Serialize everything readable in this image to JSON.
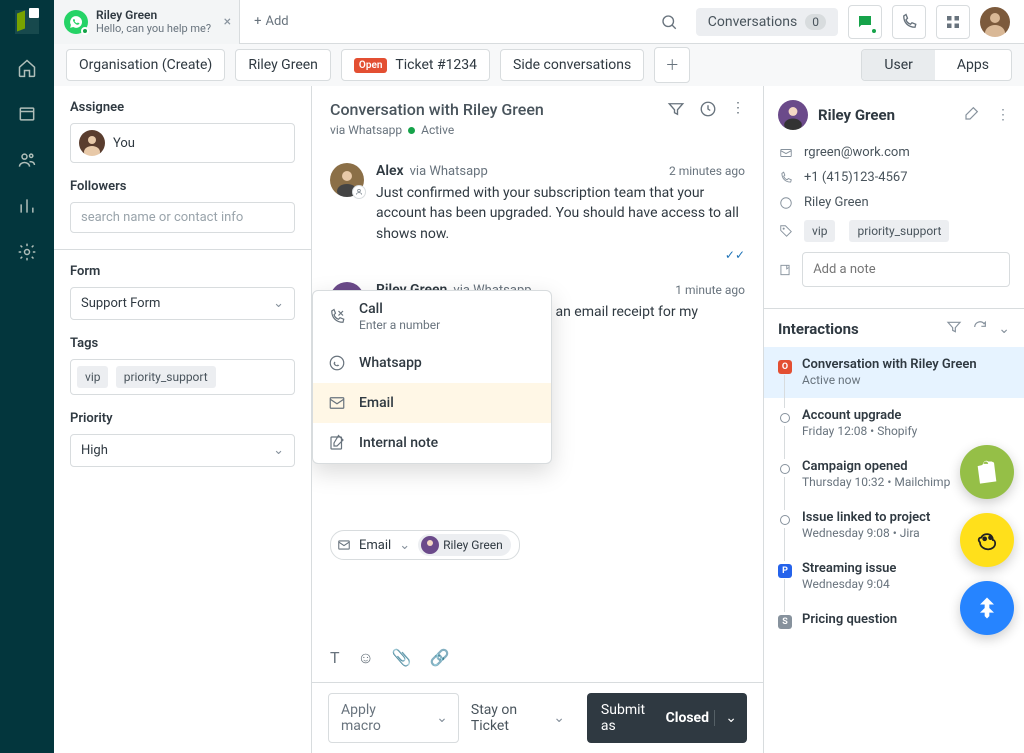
{
  "tab": {
    "name": "Riley Green",
    "preview": "Hello, can you help me?",
    "add": "Add"
  },
  "topbar": {
    "pill_label": "Conversations",
    "pill_count": "0"
  },
  "crumbs": {
    "org": "Organisation (Create)",
    "name": "Riley Green",
    "open": "Open",
    "ticket": "Ticket #1234",
    "side": "Side conversations"
  },
  "seg": {
    "user": "User",
    "apps": "Apps"
  },
  "left": {
    "assignee": "Assignee",
    "you": "You",
    "followers": "Followers",
    "followers_ph": "search name or contact info",
    "form": "Form",
    "form_val": "Support Form",
    "tags": "Tags",
    "tag1": "vip",
    "tag2": "priority_support",
    "priority": "Priority",
    "priority_val": "High"
  },
  "convo": {
    "title": "Conversation with Riley Green",
    "via": "via Whatsapp",
    "status": "Active",
    "msgs": [
      {
        "author": "Alex",
        "via": "via Whatsapp",
        "time": "2 minutes ago",
        "text": "Just confirmed with your subscription team that your account has been upgraded. You should have access to all shows now."
      },
      {
        "author": "Riley Green",
        "via": "via Whatsapp",
        "time": "1 minute ago",
        "text": "Awesome. Can you send me an email receipt for my records?"
      }
    ],
    "menu": {
      "call": "Call",
      "call_sub": "Enter a number",
      "whatsapp": "Whatsapp",
      "email": "Email",
      "note": "Internal note"
    },
    "composer": {
      "type": "Email",
      "to": "Riley Green"
    },
    "macro": "Apply macro",
    "stay": "Stay on Ticket",
    "submit_pre": "Submit as ",
    "submit_state": "Closed"
  },
  "right": {
    "name": "Riley Green",
    "email": "rgreen@work.com",
    "phone": "+1 (415)123-4567",
    "wa": "Riley Green",
    "tag1": "vip",
    "tag2": "priority_support",
    "note_ph": "Add a note",
    "interactions": "Interactions",
    "items": [
      {
        "title": "Conversation with Riley Green",
        "sub": "Active now",
        "kind": "open"
      },
      {
        "title": "Account upgrade",
        "sub": "Friday 12:08 • Shopify",
        "kind": "hollow"
      },
      {
        "title": "Campaign opened",
        "sub": "Thursday 10:32 • Mailchimp",
        "kind": "hollow"
      },
      {
        "title": "Issue linked to project",
        "sub": "Wednesday 9:08 • Jira",
        "kind": "hollow"
      },
      {
        "title": "Streaming issue",
        "sub": "Wednesday 9:04",
        "kind": "p"
      },
      {
        "title": "Pricing question",
        "sub": "",
        "kind": "s"
      }
    ]
  }
}
